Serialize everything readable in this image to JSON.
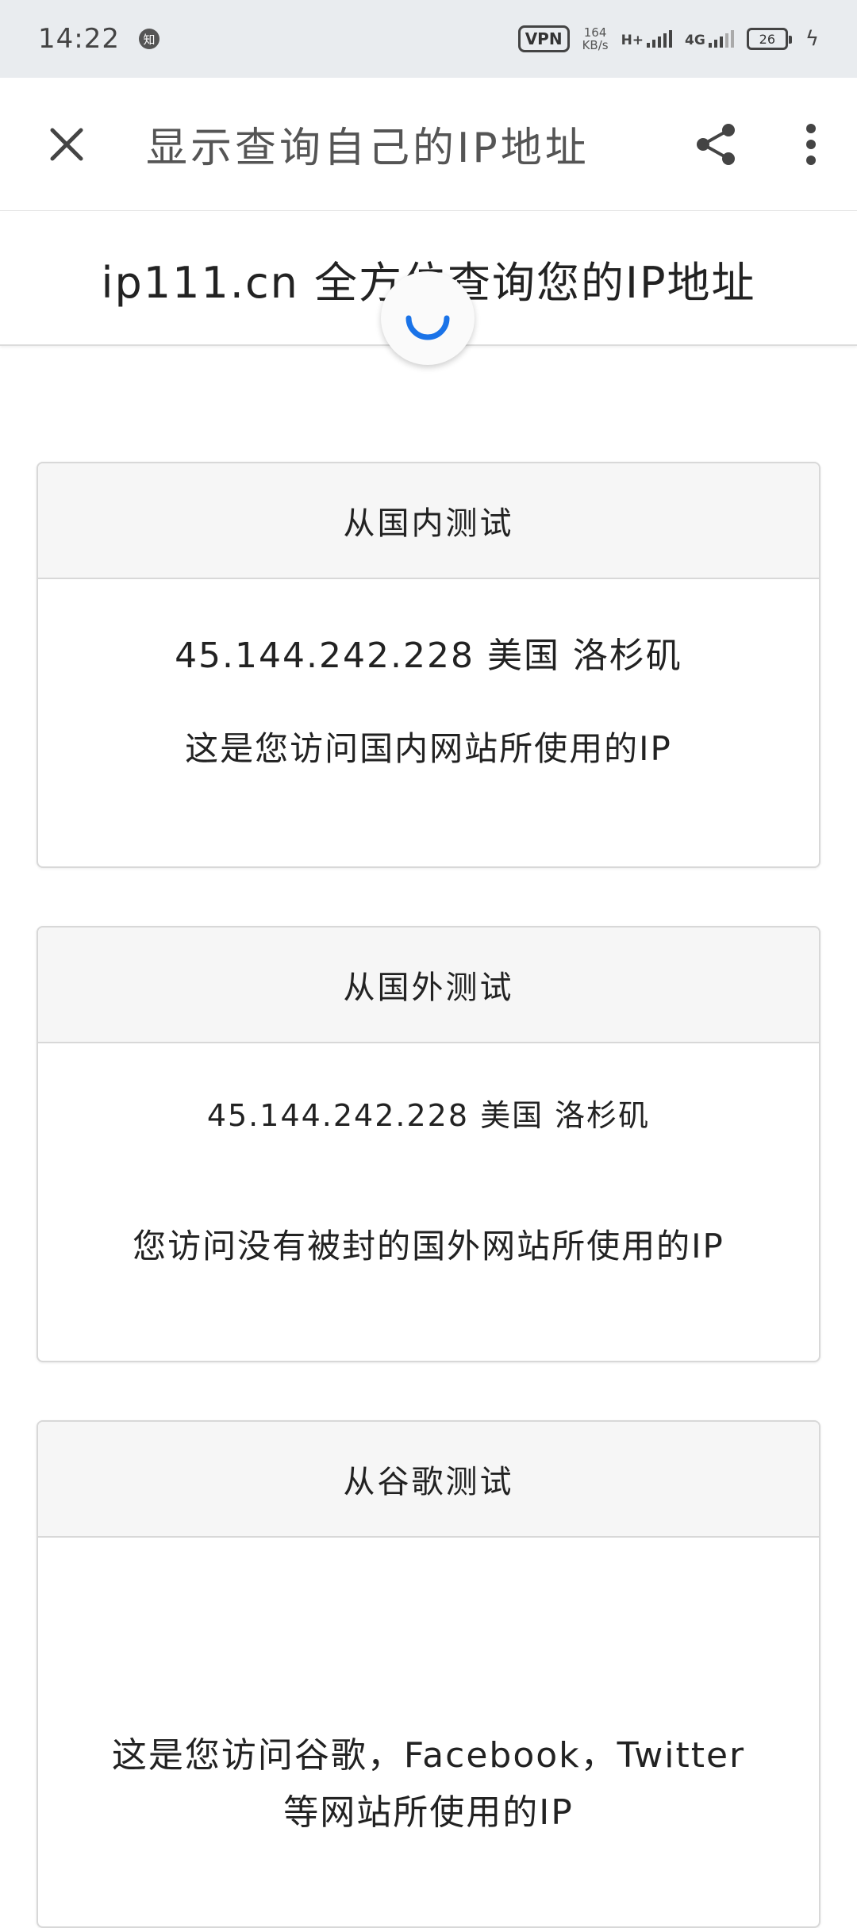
{
  "status_bar": {
    "time": "14:22",
    "notif_badge": "知",
    "vpn_label": "VPN",
    "speed_value": "164",
    "speed_unit": "KB/s",
    "net1_label": "H+",
    "net2_label": "4G",
    "battery_level": "26"
  },
  "toolbar": {
    "title": "显示查询自己的IP地址"
  },
  "page": {
    "title": "ip111.cn 全方位查询您的IP地址"
  },
  "cards": [
    {
      "header": "从国内测试",
      "ip_line": "45.144.242.228 美国 洛杉矶",
      "desc": "这是您访问国内网站所使用的IP"
    },
    {
      "header": "从国外测试",
      "ip_line": "45.144.242.228 美国 洛杉矶",
      "desc": "您访问没有被封的国外网站所使用的IP"
    },
    {
      "header": "从谷歌测试",
      "desc_line1": "这是您访问谷歌，Facebook，Twitter",
      "desc_line2": "等网站所使用的IP"
    }
  ],
  "colors": {
    "spinner": "#1a73e8",
    "status_bar_bg": "#e9ecef"
  }
}
